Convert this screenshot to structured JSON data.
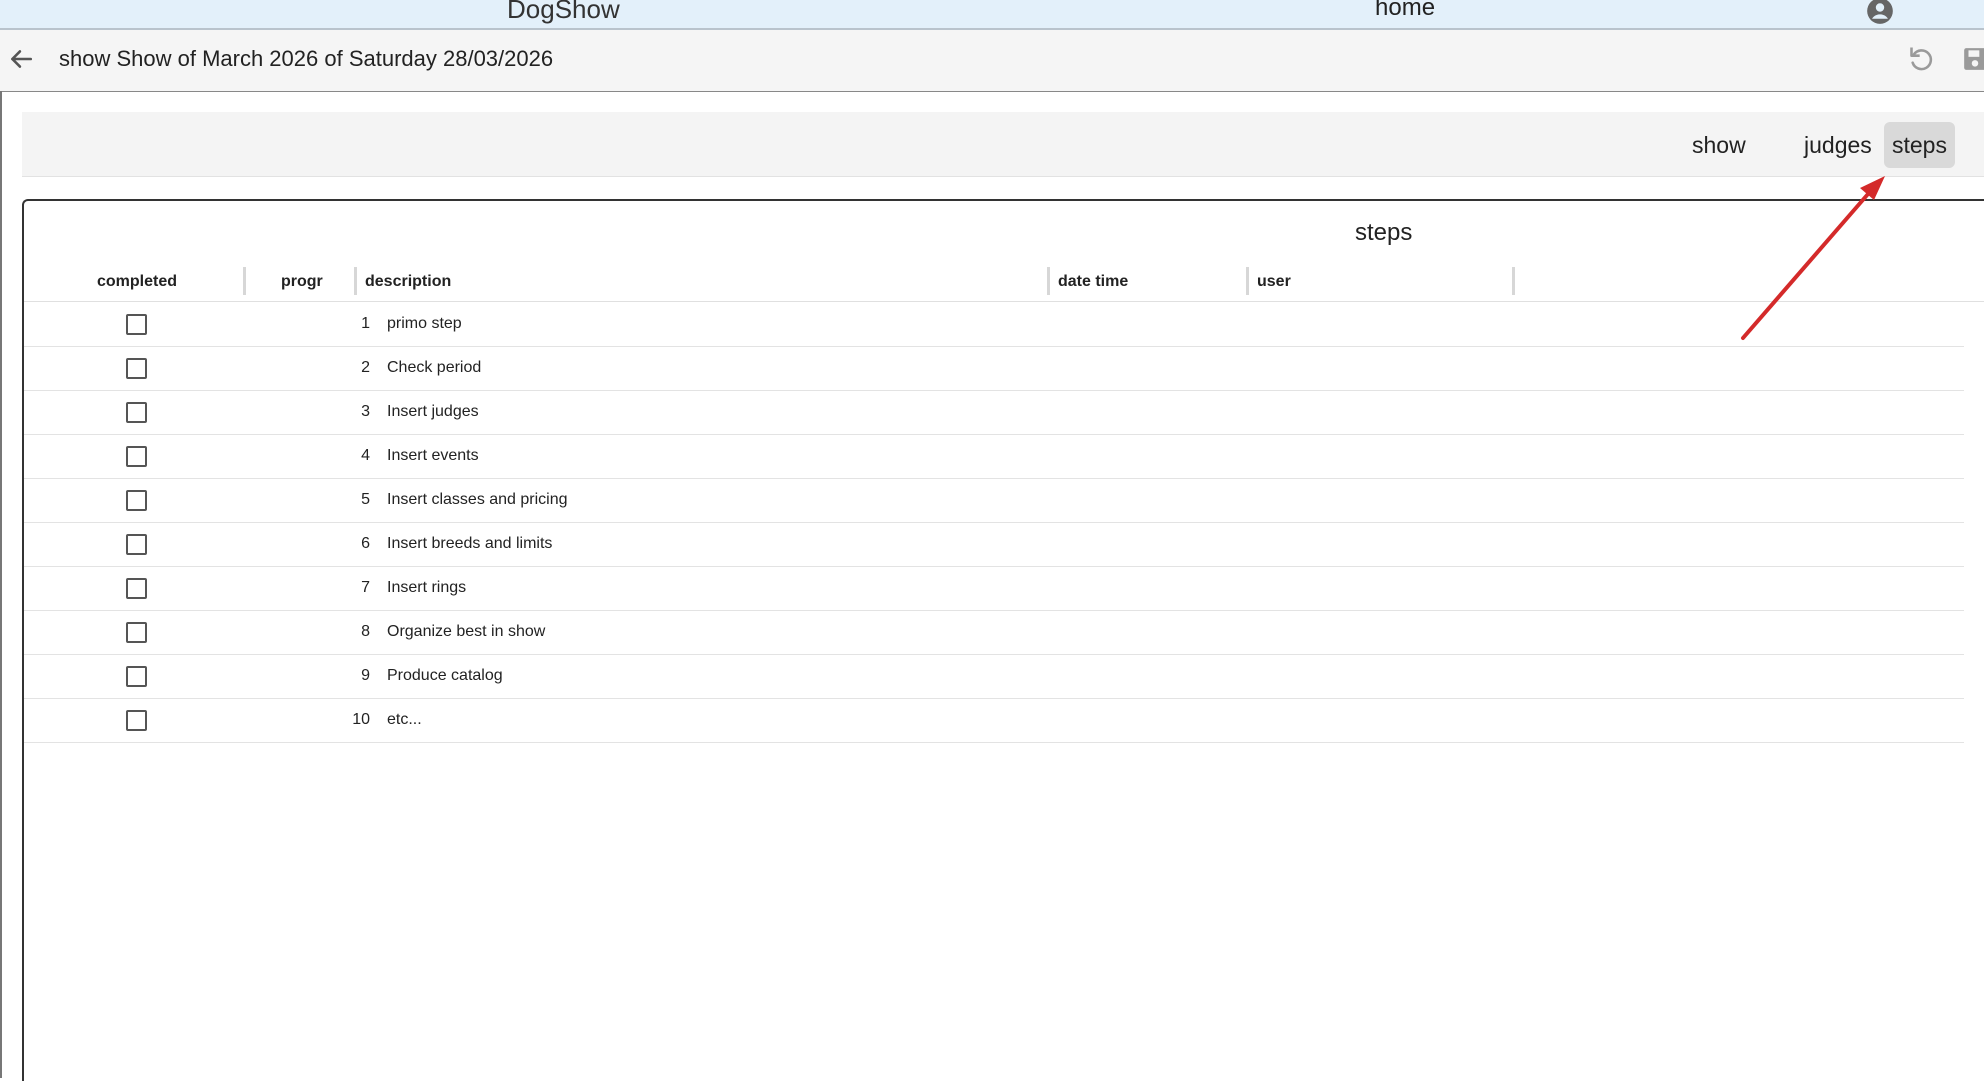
{
  "topbar": {
    "app_title": "DogShow",
    "home_label": "home"
  },
  "titlebar": {
    "title": "show Show of March 2026 of Saturday 28/03/2026"
  },
  "tabs": [
    {
      "label": "show",
      "active": false
    },
    {
      "label": "judges",
      "active": false
    },
    {
      "label": "steps",
      "active": true
    }
  ],
  "panel": {
    "title": "steps",
    "columns": {
      "completed": "completed",
      "progr": "progr",
      "description": "description",
      "date_time": "date time",
      "user": "user"
    },
    "rows": [
      {
        "completed": false,
        "progr": "1",
        "description": "primo step",
        "date_time": "",
        "user": ""
      },
      {
        "completed": false,
        "progr": "2",
        "description": "Check period",
        "date_time": "",
        "user": ""
      },
      {
        "completed": false,
        "progr": "3",
        "description": "Insert judges",
        "date_time": "",
        "user": ""
      },
      {
        "completed": false,
        "progr": "4",
        "description": "Insert events",
        "date_time": "",
        "user": ""
      },
      {
        "completed": false,
        "progr": "5",
        "description": "Insert classes and pricing",
        "date_time": "",
        "user": ""
      },
      {
        "completed": false,
        "progr": "6",
        "description": "Insert breeds and limits",
        "date_time": "",
        "user": ""
      },
      {
        "completed": false,
        "progr": "7",
        "description": "Insert rings",
        "date_time": "",
        "user": ""
      },
      {
        "completed": false,
        "progr": "8",
        "description": "Organize best in show",
        "date_time": "",
        "user": ""
      },
      {
        "completed": false,
        "progr": "9",
        "description": "Produce catalog",
        "date_time": "",
        "user": ""
      },
      {
        "completed": false,
        "progr": "10",
        "description": "etc...",
        "date_time": "",
        "user": ""
      }
    ]
  },
  "icons": {
    "back": "arrow-left-icon",
    "account": "account-circle-icon",
    "undo": "undo-icon",
    "save": "save-icon"
  },
  "annotation": {
    "arrow_color": "#d42a2a"
  },
  "colors": {
    "topbar_bg": "#e3f0fa",
    "active_tab_bg": "#d9d9d9"
  }
}
